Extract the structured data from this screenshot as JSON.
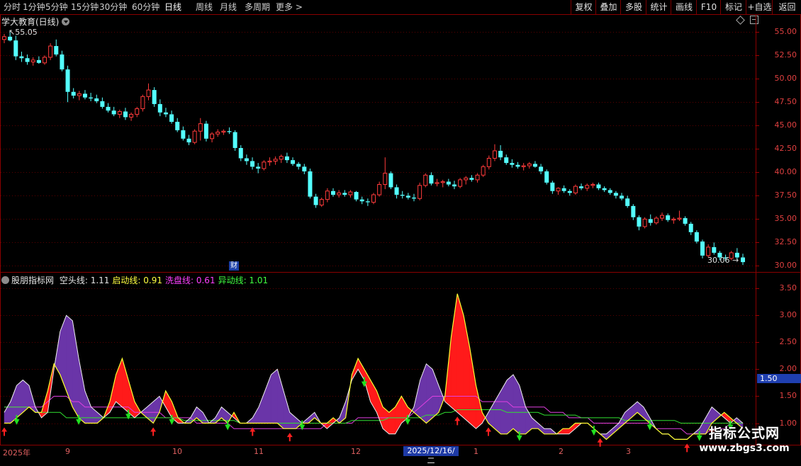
{
  "toolbar": {
    "periods": [
      "分时",
      "1分钟",
      "5分钟",
      "15分钟",
      "30分钟",
      "60分钟",
      "日线",
      "周线",
      "月线",
      "多周期",
      "更多 >"
    ],
    "active_period": "日线",
    "right_buttons": [
      "复权",
      "叠加",
      "多股",
      "统计",
      "画线",
      "F10",
      "标记",
      "+自选",
      "返回"
    ]
  },
  "main_chart": {
    "title": "学大教育(日线)",
    "high_label": "55.05",
    "low_label": "30.06",
    "y_ticks": [
      "55.00",
      "52.50",
      "50.00",
      "47.50",
      "45.00",
      "42.50",
      "40.00",
      "37.50",
      "35.00",
      "32.50",
      "30.00"
    ],
    "finance_marker": "财",
    "up_color": "#ff3b3b",
    "down_color": "#54ffff"
  },
  "indicator": {
    "name": "股朋指标网",
    "lines": [
      {
        "label": "空头线",
        "value": "1.11",
        "color": "#e6e6e6"
      },
      {
        "label": "启动线",
        "value": "0.91",
        "color": "#ffff40"
      },
      {
        "label": "洗盘线",
        "value": "0.61",
        "color": "#ff40ff"
      },
      {
        "label": "异动线",
        "value": "1.01",
        "color": "#40ff40"
      }
    ],
    "y_ticks": [
      "3.50",
      "3.00",
      "2.50",
      "2.00",
      "1.50",
      "1.00"
    ],
    "current_value": "1.50",
    "purple_fill": "#6a35a8",
    "red_fill": "#ff1a1a"
  },
  "date_axis": {
    "labels": [
      "2025年",
      "9",
      "10",
      "11",
      "12",
      "1",
      "2",
      "3"
    ],
    "highlight": "2025/12/16/二"
  },
  "watermark": {
    "title": "指标公式网",
    "url": "www.zbgs3.com"
  },
  "chart_data": {
    "type": "candlestick",
    "price_range": [
      29.5,
      56.0
    ],
    "indicator_range": [
      0.6,
      3.7
    ],
    "candles": [
      [
        54.2,
        54.8,
        53.8,
        54.5
      ],
      [
        54.5,
        55.05,
        54.0,
        54.1
      ],
      [
        54.1,
        54.6,
        52.0,
        52.4
      ],
      [
        52.4,
        52.9,
        51.8,
        52.2
      ],
      [
        52.2,
        52.6,
        51.5,
        51.8
      ],
      [
        51.8,
        52.3,
        51.4,
        52.0
      ],
      [
        52.0,
        52.4,
        51.6,
        51.7
      ],
      [
        51.7,
        52.5,
        51.5,
        52.3
      ],
      [
        52.3,
        53.8,
        52.0,
        53.5
      ],
      [
        53.5,
        54.2,
        52.4,
        52.6
      ],
      [
        52.6,
        53.0,
        50.8,
        51.0
      ],
      [
        51.0,
        51.4,
        47.5,
        48.6
      ],
      [
        48.6,
        49.0,
        47.9,
        48.2
      ],
      [
        48.2,
        48.7,
        47.7,
        48.4
      ],
      [
        48.4,
        48.8,
        47.8,
        48.0
      ],
      [
        48.0,
        48.5,
        47.6,
        47.9
      ],
      [
        47.9,
        48.3,
        47.4,
        47.6
      ],
      [
        47.6,
        48.0,
        46.8,
        47.0
      ],
      [
        47.0,
        47.4,
        46.4,
        46.6
      ],
      [
        46.6,
        47.0,
        46.0,
        46.2
      ],
      [
        46.2,
        46.7,
        45.8,
        46.5
      ],
      [
        46.5,
        46.9,
        45.6,
        45.9
      ],
      [
        45.9,
        46.4,
        45.5,
        46.2
      ],
      [
        46.2,
        47.0,
        45.9,
        46.8
      ],
      [
        46.8,
        48.3,
        46.5,
        48.1
      ],
      [
        48.1,
        49.5,
        47.7,
        48.8
      ],
      [
        48.8,
        49.1,
        47.0,
        47.3
      ],
      [
        47.3,
        47.8,
        46.0,
        46.4
      ],
      [
        46.4,
        46.9,
        45.9,
        46.2
      ],
      [
        46.2,
        46.6,
        45.2,
        45.4
      ],
      [
        45.4,
        45.8,
        44.3,
        44.5
      ],
      [
        44.5,
        44.9,
        43.4,
        43.6
      ],
      [
        43.6,
        44.0,
        42.9,
        43.2
      ],
      [
        43.2,
        44.6,
        43.0,
        44.4
      ],
      [
        44.4,
        45.8,
        43.4,
        45.2
      ],
      [
        45.2,
        45.5,
        43.3,
        43.6
      ],
      [
        43.6,
        44.3,
        43.2,
        44.1
      ],
      [
        44.1,
        44.6,
        43.8,
        44.3
      ],
      [
        44.3,
        44.6,
        44.0,
        44.4
      ],
      [
        44.4,
        44.8,
        44.1,
        44.3
      ],
      [
        44.3,
        44.5,
        42.3,
        42.6
      ],
      [
        42.6,
        42.9,
        41.2,
        41.5
      ],
      [
        41.5,
        41.9,
        40.8,
        41.2
      ],
      [
        41.2,
        41.6,
        40.3,
        40.6
      ],
      [
        40.6,
        41.0,
        39.9,
        40.4
      ],
      [
        40.4,
        41.3,
        40.2,
        41.1
      ],
      [
        41.1,
        41.6,
        40.7,
        41.2
      ],
      [
        41.2,
        41.7,
        40.8,
        41.4
      ],
      [
        41.4,
        41.9,
        41.0,
        41.7
      ],
      [
        41.7,
        42.1,
        41.0,
        41.3
      ],
      [
        41.3,
        41.6,
        40.7,
        40.9
      ],
      [
        40.9,
        41.1,
        40.3,
        40.6
      ],
      [
        40.6,
        40.9,
        39.8,
        40.1
      ],
      [
        40.1,
        40.4,
        37.2,
        37.4
      ],
      [
        37.4,
        37.7,
        36.2,
        36.5
      ],
      [
        36.5,
        37.3,
        36.3,
        37.1
      ],
      [
        37.1,
        38.3,
        36.8,
        38.0
      ],
      [
        38.0,
        38.3,
        37.4,
        37.6
      ],
      [
        37.6,
        38.1,
        37.3,
        37.8
      ],
      [
        37.8,
        38.1,
        37.4,
        37.6
      ],
      [
        37.6,
        38.1,
        37.3,
        37.9
      ],
      [
        37.9,
        38.0,
        36.9,
        37.1
      ],
      [
        37.1,
        37.4,
        36.6,
        36.9
      ],
      [
        36.9,
        37.2,
        36.4,
        36.8
      ],
      [
        36.8,
        37.8,
        36.6,
        37.6
      ],
      [
        37.6,
        39.0,
        37.4,
        38.7
      ],
      [
        38.7,
        41.6,
        38.2,
        39.9
      ],
      [
        39.9,
        40.1,
        38.2,
        38.4
      ],
      [
        38.4,
        38.7,
        37.2,
        37.6
      ],
      [
        37.6,
        38.0,
        37.2,
        37.5
      ],
      [
        37.5,
        37.8,
        37.1,
        37.3
      ],
      [
        37.3,
        37.7,
        36.9,
        37.2
      ],
      [
        37.2,
        38.9,
        37.0,
        38.6
      ],
      [
        38.6,
        39.9,
        38.4,
        39.7
      ],
      [
        39.7,
        40.0,
        38.6,
        38.8
      ],
      [
        38.8,
        39.3,
        38.5,
        38.9
      ],
      [
        38.9,
        39.2,
        38.4,
        39.0
      ],
      [
        39.0,
        39.3,
        38.5,
        38.7
      ],
      [
        38.7,
        39.1,
        38.2,
        38.5
      ],
      [
        38.5,
        39.4,
        38.3,
        39.2
      ],
      [
        39.2,
        39.6,
        38.7,
        39.4
      ],
      [
        39.4,
        39.7,
        39.0,
        39.2
      ],
      [
        39.2,
        39.9,
        38.9,
        39.7
      ],
      [
        39.7,
        40.8,
        39.5,
        40.6
      ],
      [
        40.6,
        41.8,
        40.3,
        41.5
      ],
      [
        41.5,
        43.0,
        41.2,
        42.3
      ],
      [
        42.3,
        42.9,
        41.3,
        41.6
      ],
      [
        41.6,
        41.9,
        40.8,
        41.0
      ],
      [
        41.0,
        41.4,
        40.5,
        40.8
      ],
      [
        40.8,
        41.1,
        40.4,
        40.6
      ],
      [
        40.6,
        41.0,
        40.2,
        40.7
      ],
      [
        40.7,
        41.1,
        40.4,
        40.9
      ],
      [
        40.9,
        41.2,
        40.5,
        40.6
      ],
      [
        40.6,
        40.9,
        39.8,
        40.1
      ],
      [
        40.1,
        40.3,
        38.7,
        38.9
      ],
      [
        38.9,
        39.1,
        37.7,
        38.0
      ],
      [
        38.0,
        38.4,
        37.6,
        38.3
      ],
      [
        38.3,
        38.6,
        37.8,
        38.0
      ],
      [
        38.0,
        38.2,
        37.5,
        37.8
      ],
      [
        37.8,
        38.7,
        37.6,
        38.5
      ],
      [
        38.5,
        38.8,
        38.1,
        38.3
      ],
      [
        38.3,
        38.8,
        38.0,
        38.6
      ],
      [
        38.6,
        38.9,
        38.3,
        38.7
      ],
      [
        38.7,
        38.9,
        38.1,
        38.3
      ],
      [
        38.3,
        38.5,
        37.9,
        38.1
      ],
      [
        38.1,
        38.3,
        37.6,
        37.8
      ],
      [
        37.8,
        38.0,
        37.2,
        37.5
      ],
      [
        37.5,
        37.8,
        37.0,
        37.2
      ],
      [
        37.2,
        37.5,
        36.2,
        36.4
      ],
      [
        36.4,
        36.6,
        34.9,
        35.2
      ],
      [
        35.2,
        35.4,
        33.8,
        34.2
      ],
      [
        34.2,
        35.2,
        34.0,
        35.0
      ],
      [
        35.0,
        35.5,
        34.3,
        34.6
      ],
      [
        34.6,
        35.3,
        34.4,
        35.1
      ],
      [
        35.1,
        35.7,
        34.8,
        35.4
      ],
      [
        35.4,
        35.6,
        34.7,
        34.9
      ],
      [
        34.9,
        35.2,
        34.5,
        35.0
      ],
      [
        35.0,
        35.9,
        34.8,
        35.1
      ],
      [
        35.1,
        35.3,
        34.3,
        34.5
      ],
      [
        34.5,
        34.7,
        33.3,
        33.6
      ],
      [
        33.6,
        33.8,
        32.4,
        32.6
      ],
      [
        32.6,
        32.8,
        30.8,
        31.1
      ],
      [
        31.1,
        32.3,
        30.9,
        32.0
      ],
      [
        32.0,
        32.5,
        31.2,
        31.4
      ],
      [
        31.4,
        31.6,
        30.6,
        30.9
      ],
      [
        30.9,
        31.2,
        30.5,
        30.8
      ],
      [
        30.8,
        31.6,
        30.6,
        31.4
      ],
      [
        31.4,
        31.9,
        30.7,
        30.9
      ],
      [
        30.9,
        31.3,
        30.1,
        30.4
      ]
    ],
    "indicator_series": {
      "bear": [
        1.2,
        1.4,
        1.7,
        1.8,
        1.7,
        1.3,
        1.1,
        1.2,
        2.0,
        2.7,
        3.0,
        2.9,
        2.2,
        1.6,
        1.3,
        1.2,
        1.1,
        1.2,
        1.4,
        1.3,
        1.2,
        1.1,
        1.2,
        1.3,
        1.4,
        1.5,
        1.3,
        1.1,
        1.0,
        1.0,
        1.1,
        1.3,
        1.2,
        1.0,
        1.1,
        1.3,
        1.2,
        1.1,
        1.0,
        1.0,
        1.1,
        1.3,
        1.6,
        1.9,
        2.0,
        1.6,
        1.2,
        1.1,
        1.0,
        1.1,
        1.2,
        1.0,
        0.9,
        1.0,
        1.1,
        1.4,
        1.8,
        2.0,
        1.8,
        1.4,
        1.2,
        0.9,
        0.8,
        0.8,
        1.0,
        1.1,
        1.3,
        1.8,
        2.1,
        2.0,
        1.7,
        1.4,
        1.3,
        1.2,
        1.1,
        1.0,
        0.9,
        1.0,
        1.2,
        1.4,
        1.6,
        1.8,
        1.9,
        1.7,
        1.3,
        1.1,
        1.0,
        0.9,
        0.9,
        0.8,
        0.8,
        0.8,
        0.9,
        1.0,
        1.0,
        0.9,
        0.8,
        0.8,
        0.9,
        1.0,
        1.2,
        1.3,
        1.4,
        1.3,
        1.1,
        0.9,
        0.8,
        0.8,
        0.7,
        0.7,
        0.7,
        0.8,
        0.9,
        1.1,
        1.3,
        1.2,
        1.1,
        1.0,
        1.1,
        1.0
      ],
      "start": [
        1.0,
        1.0,
        1.1,
        1.2,
        1.3,
        1.2,
        1.2,
        1.6,
        2.1,
        1.9,
        1.6,
        1.3,
        1.1,
        1.0,
        1.0,
        1.0,
        1.1,
        1.4,
        1.9,
        2.2,
        1.8,
        1.4,
        1.2,
        1.1,
        1.0,
        1.2,
        1.6,
        1.4,
        1.1,
        1.0,
        1.0,
        1.1,
        1.0,
        1.0,
        1.0,
        1.1,
        1.0,
        1.2,
        1.0,
        1.0,
        1.0,
        1.0,
        1.0,
        1.0,
        1.0,
        0.9,
        0.9,
        0.9,
        1.0,
        1.0,
        1.1,
        1.0,
        1.0,
        1.1,
        1.0,
        1.1,
        1.9,
        2.2,
        2.0,
        1.8,
        1.6,
        1.3,
        1.2,
        1.3,
        1.5,
        1.3,
        1.2,
        1.1,
        1.0,
        1.1,
        1.2,
        1.5,
        2.6,
        3.4,
        3.0,
        2.4,
        1.7,
        1.2,
        1.0,
        0.9,
        0.8,
        0.8,
        0.9,
        0.8,
        0.8,
        0.9,
        0.9,
        0.8,
        0.8,
        0.8,
        0.9,
        0.9,
        1.0,
        1.0,
        1.0,
        0.9,
        0.8,
        0.7,
        0.8,
        0.9,
        1.0,
        1.1,
        1.2,
        1.1,
        1.0,
        0.9,
        0.8,
        0.8,
        0.7,
        0.7,
        0.7,
        0.8,
        0.8,
        0.8,
        1.0,
        1.1,
        1.2,
        1.1,
        1.0,
        0.9
      ],
      "wash": [
        1.3,
        1.3,
        1.3,
        1.3,
        1.3,
        1.3,
        1.3,
        1.4,
        1.5,
        1.5,
        1.5,
        1.4,
        1.4,
        1.3,
        1.3,
        1.3,
        1.3,
        1.3,
        1.3,
        1.3,
        1.3,
        1.2,
        1.2,
        1.2,
        1.2,
        1.2,
        1.1,
        1.1,
        1.1,
        1.1,
        1.1,
        1.0,
        1.0,
        1.0,
        1.0,
        1.0,
        1.0,
        0.9,
        0.9,
        0.9,
        0.9,
        0.9,
        0.9,
        0.9,
        0.9,
        0.9,
        0.9,
        0.9,
        0.9,
        0.9,
        0.9,
        0.9,
        1.0,
        1.0,
        1.0,
        1.0,
        1.0,
        1.1,
        1.1,
        1.1,
        1.1,
        1.1,
        1.1,
        1.1,
        1.1,
        1.1,
        1.2,
        1.3,
        1.4,
        1.5,
        1.5,
        1.5,
        1.5,
        1.5,
        1.5,
        1.5,
        1.5,
        1.4,
        1.4,
        1.4,
        1.4,
        1.4,
        1.3,
        1.3,
        1.3,
        1.3,
        1.3,
        1.3,
        1.2,
        1.2,
        1.2,
        1.1,
        1.1,
        1.1,
        1.1,
        1.0,
        1.0,
        1.0,
        1.0,
        1.0,
        1.0,
        1.0,
        1.0,
        1.0,
        1.0,
        0.9,
        0.9,
        0.9,
        0.9,
        0.9,
        0.8,
        0.8,
        0.8,
        0.8,
        0.9,
        0.9,
        0.9,
        1.0,
        1.0,
        1.0
      ],
      "abnormal": [
        1.3,
        1.3,
        1.3,
        1.3,
        1.3,
        1.2,
        1.2,
        1.2,
        1.2,
        1.2,
        1.1,
        1.1,
        1.1,
        1.1,
        1.1,
        1.1,
        1.1,
        1.1,
        1.1,
        1.1,
        1.1,
        1.1,
        1.1,
        1.1,
        1.1,
        1.1,
        1.1,
        1.1,
        1.1,
        1.05,
        1.05,
        1.05,
        1.05,
        1.05,
        1.05,
        1.05,
        1.05,
        1.05,
        1.0,
        1.0,
        1.0,
        1.0,
        1.0,
        1.0,
        1.0,
        1.0,
        1.0,
        1.0,
        1.0,
        1.0,
        1.0,
        1.0,
        1.0,
        1.0,
        1.0,
        1.0,
        1.05,
        1.05,
        1.05,
        1.05,
        1.05,
        1.05,
        1.1,
        1.1,
        1.1,
        1.1,
        1.1,
        1.1,
        1.15,
        1.15,
        1.15,
        1.2,
        1.2,
        1.25,
        1.25,
        1.25,
        1.25,
        1.25,
        1.25,
        1.25,
        1.25,
        1.2,
        1.2,
        1.2,
        1.2,
        1.2,
        1.2,
        1.15,
        1.15,
        1.15,
        1.15,
        1.15,
        1.15,
        1.1,
        1.1,
        1.1,
        1.1,
        1.1,
        1.1,
        1.1,
        1.05,
        1.05,
        1.05,
        1.05,
        1.05,
        1.05,
        1.05,
        1.05,
        1.05,
        1.0,
        1.0,
        1.0,
        1.0,
        1.0,
        1.0,
        1.0,
        1.0,
        1.0,
        1.0,
        1.0
      ]
    },
    "signals_up_idx": [
      2,
      12,
      20,
      27,
      36,
      48,
      58,
      65,
      83,
      95,
      104,
      112,
      117
    ],
    "signals_up_red_idx": [
      0,
      24,
      40,
      46,
      73,
      78,
      96,
      110,
      114
    ]
  }
}
